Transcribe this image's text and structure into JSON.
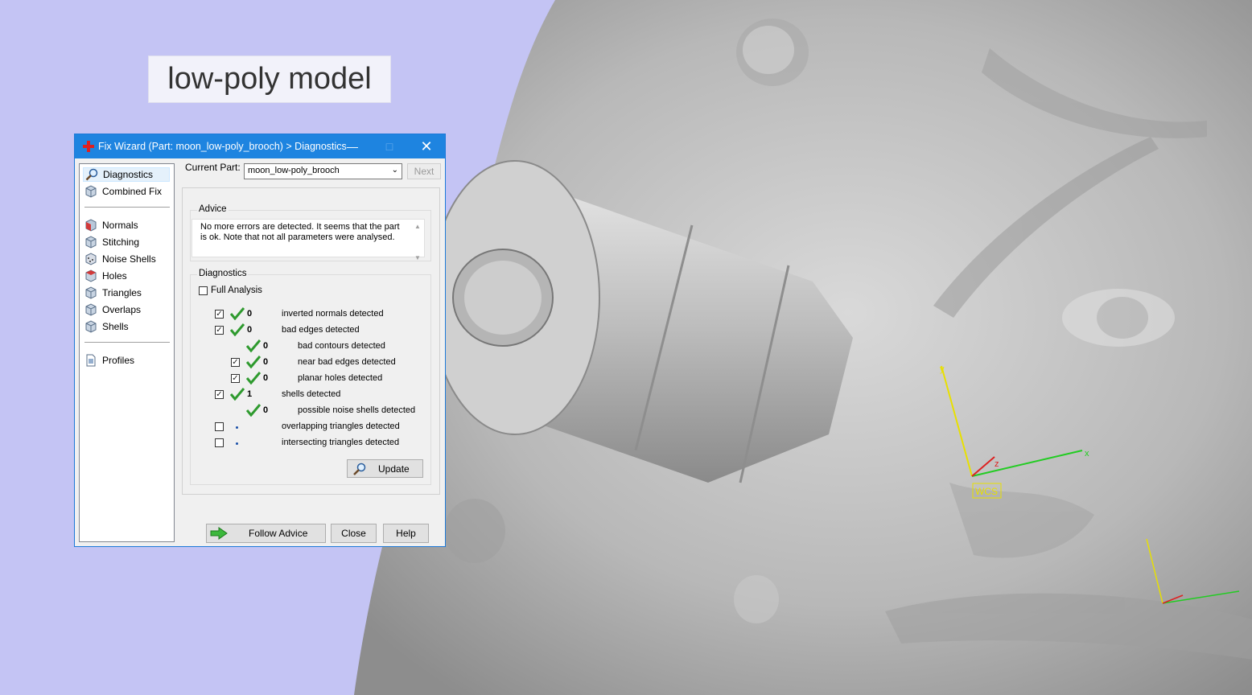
{
  "overlay_label": "low-poly model",
  "viewport": {
    "axis_label": "WCS",
    "axis_x": "x",
    "axis_y": "y",
    "axis_z": "z"
  },
  "dialog": {
    "title": "Fix Wizard (Part: moon_low-poly_brooch) > Diagnostics",
    "nav": {
      "items": [
        {
          "label": "Diagnostics",
          "icon": "magnifier-icon"
        },
        {
          "label": "Combined Fix",
          "icon": "cube-icon"
        },
        {
          "label": "Normals",
          "icon": "normals-cube-icon"
        },
        {
          "label": "Stitching",
          "icon": "stitching-cube-icon"
        },
        {
          "label": "Noise Shells",
          "icon": "noise-shells-icon"
        },
        {
          "label": "Holes",
          "icon": "holes-cube-icon"
        },
        {
          "label": "Triangles",
          "icon": "triangles-cube-icon"
        },
        {
          "label": "Overlaps",
          "icon": "overlaps-cube-icon"
        },
        {
          "label": "Shells",
          "icon": "shells-cube-icon"
        },
        {
          "label": "Profiles",
          "icon": "document-icon"
        }
      ]
    },
    "current_part_label": "Current Part:",
    "current_part_value": "moon_low-poly_brooch",
    "next_label": "Next",
    "advice": {
      "title": "Advice",
      "text": "No more errors are detected. It seems that the part is ok. Note that not all parameters were analysed."
    },
    "diagnostics": {
      "title": "Diagnostics",
      "full_analysis_label": "Full Analysis",
      "rows": [
        {
          "count": "0",
          "label": "inverted normals detected"
        },
        {
          "count": "0",
          "label": "bad edges detected"
        },
        {
          "count": "0",
          "label": "bad contours detected"
        },
        {
          "count": "0",
          "label": "near bad edges detected"
        },
        {
          "count": "0",
          "label": "planar holes detected"
        },
        {
          "count": "1",
          "label": "shells detected"
        },
        {
          "count": "0",
          "label": "possible noise shells detected"
        },
        {
          "count": "",
          "label": "overlapping triangles detected"
        },
        {
          "count": "",
          "label": "intersecting triangles detected"
        }
      ],
      "update_label": "Update"
    },
    "buttons": {
      "follow_advice": "Follow Advice",
      "close": "Close",
      "help": "Help"
    }
  }
}
